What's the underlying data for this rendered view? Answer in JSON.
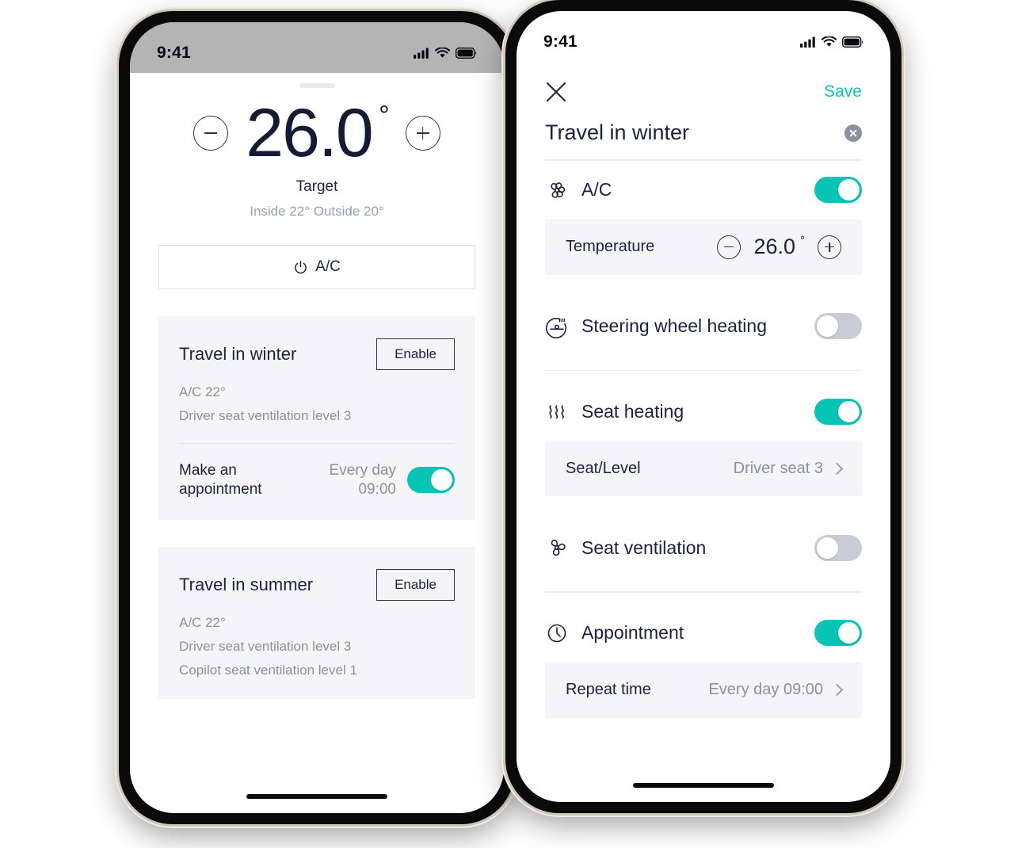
{
  "status_bar": {
    "time": "9:41",
    "icons": [
      "cellular-signal-icon",
      "wifi-icon",
      "battery-icon"
    ]
  },
  "left_phone": {
    "climate": {
      "temperature": "26.0",
      "degree_symbol": "°",
      "decrease_label": "−",
      "increase_label": "+",
      "target_label": "Target",
      "ambient": "Inside 22°  Outside 20°"
    },
    "ac_button": {
      "label": "A/C",
      "icon": "power-icon"
    },
    "cards": [
      {
        "title": "Travel in winter",
        "action_label": "Enable",
        "details": [
          "A/C 22°",
          "Driver seat ventilation level 3"
        ],
        "appointment": {
          "label_line1": "Make an",
          "label_line2": "appointment",
          "value_line1": "Every day",
          "value_line2": "09:00",
          "enabled": true
        }
      },
      {
        "title": "Travel in summer",
        "action_label": "Enable",
        "details": [
          "A/C 22°",
          "Driver seat ventilation level 3",
          "Copilot seat ventilation level 1"
        ],
        "appointment": null
      }
    ]
  },
  "right_phone": {
    "nav": {
      "close_icon": "close-icon",
      "save_label": "Save"
    },
    "title": "Travel in winter",
    "clear_icon": "clear-circle-icon",
    "rows": [
      {
        "icon": "fan-icon",
        "label": "A/C",
        "toggle": "on",
        "sub": {
          "label": "Temperature",
          "type": "stepper",
          "value": "26.0",
          "degree": "°"
        }
      },
      {
        "icon": "steering-wheel-heating-icon",
        "label": "Steering wheel heating",
        "toggle": "off",
        "sub": null
      },
      {
        "icon": "seat-heating-icon",
        "label": "Seat heating",
        "toggle": "on",
        "sub": {
          "label": "Seat/Level",
          "type": "link",
          "value": "Driver seat 3"
        }
      },
      {
        "icon": "seat-ventilation-icon",
        "label": "Seat ventilation",
        "toggle": "off",
        "sub": null
      },
      {
        "icon": "clock-icon",
        "label": "Appointment",
        "toggle": "on",
        "sub": {
          "label": "Repeat time",
          "type": "link",
          "value": "Every day 09:00"
        }
      }
    ]
  },
  "colors": {
    "accent_teal": "#06c5b6",
    "ink": "#1b2240",
    "muted": "#8a909f",
    "card_bg": "#f5f5f7",
    "toggle_off": "#c9ccd4"
  }
}
